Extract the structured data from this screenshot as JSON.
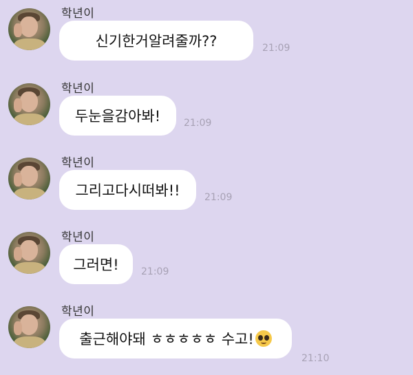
{
  "chat": {
    "messages": [
      {
        "sender": "학년이",
        "text": "신기한거알려줄까??",
        "time": "21:09"
      },
      {
        "sender": "학년이",
        "text": "두눈을감아봐!",
        "time": "21:09"
      },
      {
        "sender": "학년이",
        "text": "그리고다시떠봐!!",
        "time": "21:09"
      },
      {
        "sender": "학년이",
        "text": "그러면!",
        "time": "21:09"
      },
      {
        "sender": "학년이",
        "text": "출근해야돼 ㅎㅎㅎㅎㅎ 수고!",
        "time": "21:10",
        "emoji": "pleading-face-emoji"
      }
    ]
  },
  "colors": {
    "background": "#ddd6ef",
    "bubble": "#ffffff",
    "time": "#a7a1b4"
  }
}
